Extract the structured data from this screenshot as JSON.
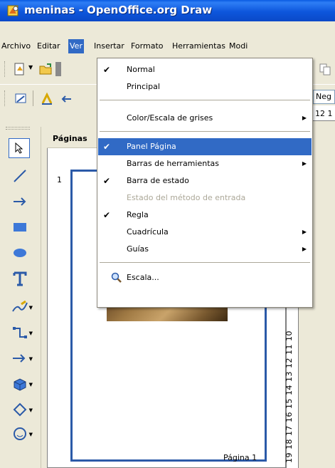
{
  "window": {
    "title": "meninas - OpenOffice.org Draw"
  },
  "menubar": {
    "items": [
      "Archivo",
      "Editar",
      "Ver",
      "Insertar",
      "Formato",
      "Herramientas",
      "Modi"
    ]
  },
  "toolbar": {
    "combo_value": "Neg"
  },
  "pages_panel": {
    "header": "Páginas",
    "page_number": "1",
    "page_label": "Página 1"
  },
  "ruler": {
    "vertical_text": "19 18 17 16 15 14 13 12 11 10",
    "top_text": "12 1"
  },
  "menu": {
    "items": [
      {
        "label": "Normal",
        "checked": true
      },
      {
        "label": "Principal",
        "checked": false
      },
      {
        "label": "Color/Escala de grises",
        "submenu": true
      },
      {
        "label": "Panel Página",
        "checked": true,
        "highlighted": true
      },
      {
        "label": "Barras de herramientas",
        "submenu": true
      },
      {
        "label": "Barra de estado",
        "checked": true
      },
      {
        "label": "Estado del método de entrada",
        "disabled": true
      },
      {
        "label": "Regla",
        "checked": true
      },
      {
        "label": "Cuadrícula",
        "submenu": true
      },
      {
        "label": "Guías",
        "submenu": true
      },
      {
        "label": "Escala...",
        "icon": "magnifier-icon"
      }
    ]
  },
  "colors": {
    "highlight": "#316ac5",
    "titlebar": "#0a5be2",
    "page_border": "#2b5aa8"
  }
}
